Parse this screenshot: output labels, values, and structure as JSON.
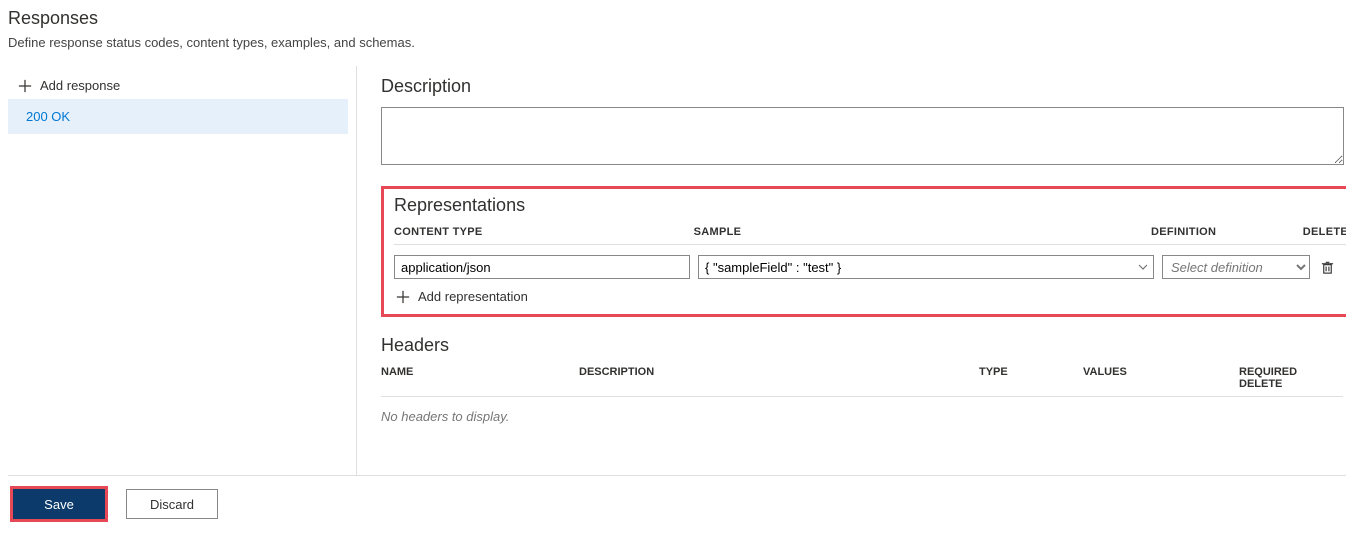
{
  "page": {
    "title": "Responses",
    "subtitle": "Define response status codes, content types, examples, and schemas."
  },
  "sidebar": {
    "add_response_label": "Add response",
    "items": [
      {
        "label": "200 OK"
      }
    ]
  },
  "description": {
    "heading": "Description",
    "value": ""
  },
  "representations": {
    "heading": "Representations",
    "columns": {
      "content_type": "CONTENT TYPE",
      "sample": "SAMPLE",
      "definition": "DEFINITION",
      "delete": "DELETE"
    },
    "rows": [
      {
        "content_type": "application/json",
        "sample": "{ \"sampleField\" : \"test\" }",
        "definition_placeholder": "Select definition"
      }
    ],
    "add_label": "Add representation"
  },
  "headers": {
    "heading": "Headers",
    "columns": {
      "name": "NAME",
      "description": "DESCRIPTION",
      "type": "TYPE",
      "values": "VALUES",
      "required_delete": "REQUIRED DELETE"
    },
    "empty_text": "No headers to display."
  },
  "footer": {
    "save_label": "Save",
    "discard_label": "Discard"
  }
}
